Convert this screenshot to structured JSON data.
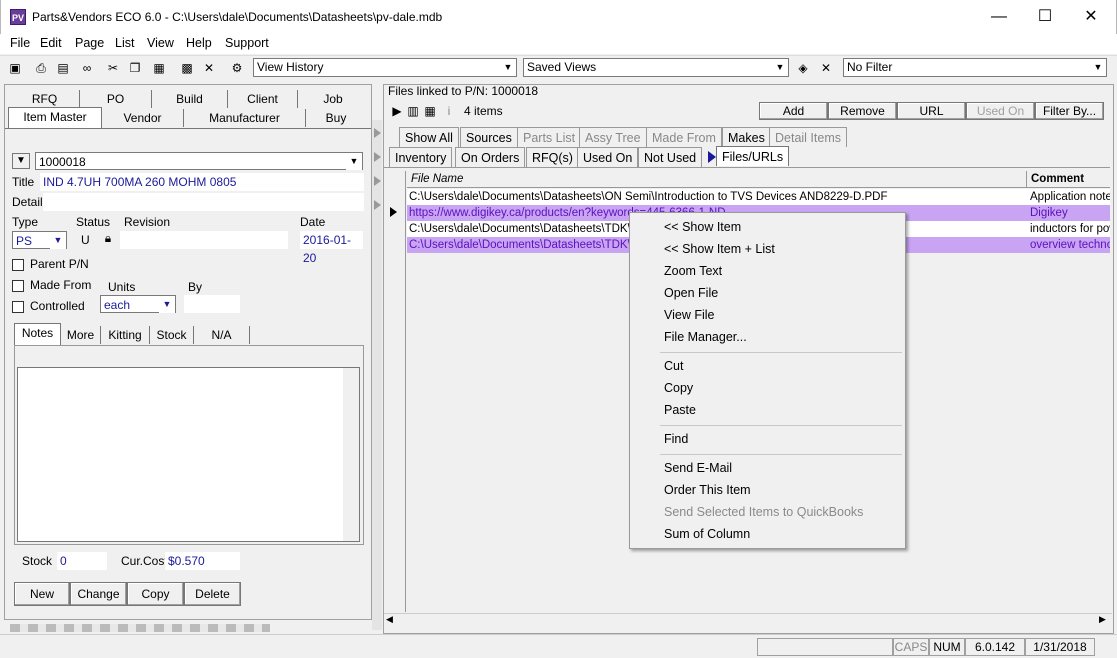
{
  "window": {
    "title": "Parts&Vendors ECO 6.0 - C:\\Users\\dale\\Documents\\Datasheets\\pv-dale.mdb",
    "icon": "pv-app-icon"
  },
  "menu": [
    "File",
    "Edit",
    "Page",
    "List",
    "View",
    "Help",
    "Support"
  ],
  "toolbar": {
    "history": "View History",
    "saved_views": "Saved Views",
    "filter": "No Filter"
  },
  "left_tabs_row1": [
    "RFQ",
    "PO",
    "Build",
    "Client",
    "Job"
  ],
  "left_tabs_row2": [
    "Item Master",
    "Vendor",
    "Manufacturer",
    "Buy"
  ],
  "item": {
    "pn": "1000018",
    "title_label": "Title",
    "title": "IND 4.7UH 700MA 260 MOHM 0805",
    "detail_label": "Detail",
    "detail": "",
    "type_label": "Type",
    "type": "PS",
    "status_label": "Status",
    "status": "U",
    "revision_label": "Revision",
    "revision": "",
    "date_label": "Date",
    "date": "2016-01-20",
    "parent_label": "Parent P/N",
    "made_from_label": "Made From",
    "controlled_label": "Controlled",
    "units_label": "Units",
    "units": "each",
    "by_label": "By",
    "by": ""
  },
  "sub_tabs": [
    "Notes",
    "More",
    "Kitting",
    "Stock",
    "N/A"
  ],
  "stock": {
    "stock_label": "Stock",
    "stock": "0",
    "cost_label": "Cur.Cost",
    "cost": "$0.570"
  },
  "buttons": {
    "new": "New",
    "change": "Change",
    "copy": "Copy",
    "delete": "Delete"
  },
  "right": {
    "files_linked": "Files linked to P/N: 1000018",
    "count": "4 items",
    "add": "Add",
    "remove": "Remove",
    "url": "URL",
    "used_on": "Used On",
    "filter_by": "Filter By..."
  },
  "rtabs1": [
    "Show All",
    "Sources",
    "Parts List",
    "Assy Tree",
    "Made From",
    "Makes",
    "Detail Items"
  ],
  "rtabs2": [
    "Inventory",
    "On Orders",
    "RFQ(s)",
    "Used On",
    "Not Used",
    "Files/URLs"
  ],
  "grid": {
    "col_file": "File Name",
    "col_comment": "Comment",
    "rows": [
      {
        "file": "C:\\Users\\dale\\Documents\\Datasheets\\ON Semi\\Introduction to TVS Devices AND8229-D.PDF",
        "comment": "Application note"
      },
      {
        "file": "https://www.digikey.ca/products/en?keywords=445-6366-1-ND",
        "comment": "Digikey"
      },
      {
        "file": "C:\\Users\\dale\\Documents\\Datasheets\\TDK\\i",
        "comment": "inductors for pow"
      },
      {
        "file": "C:\\Users\\dale\\Documents\\Datasheets\\TDK\\T",
        "comment": "overview techno"
      }
    ]
  },
  "context_menu": [
    "<< Show Item",
    "<< Show Item + List",
    "Zoom Text",
    "Open File",
    "View File",
    "File Manager...",
    "Cut",
    "Copy",
    "Paste",
    "Find",
    "Send E-Mail",
    "Order This Item",
    "Send Selected Items to QuickBooks",
    "Sum of Column"
  ],
  "status": {
    "caps": "CAPS",
    "num": "NUM",
    "version": "6.0.142",
    "date": "1/31/2018"
  }
}
